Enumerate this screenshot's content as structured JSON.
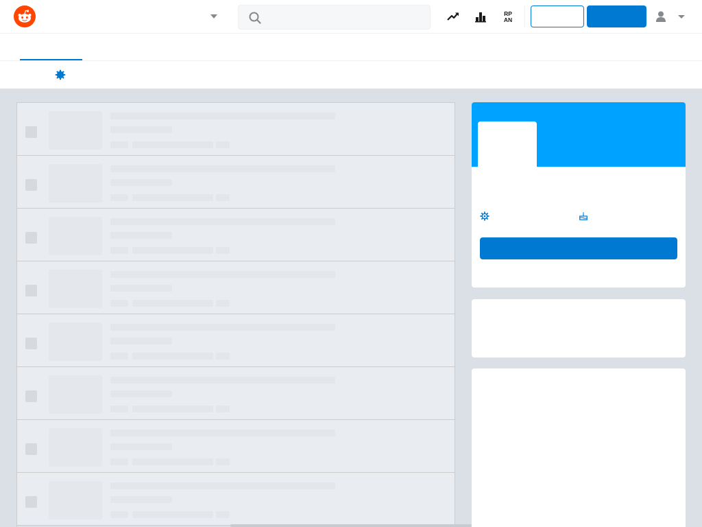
{
  "header": {
    "logo_icon": "reddit-alien-icon",
    "search": {
      "placeholder": "",
      "value": ""
    },
    "icons": [
      "trending-icon",
      "popular-chart-icon",
      "rpan-icon",
      "chevron-down-icon",
      "user-icon"
    ],
    "login_label": "",
    "signup_label": ""
  },
  "subnav": {
    "active_tab_label": ""
  },
  "colors": {
    "accent": "#0079d3",
    "banner": "#00a2ff",
    "logo": "#ff4500",
    "background": "#dae0e6"
  },
  "feed": {
    "posts": [
      {
        "title": "",
        "meta": ""
      },
      {
        "title": "",
        "meta": ""
      },
      {
        "title": "",
        "meta": ""
      },
      {
        "title": "",
        "meta": ""
      },
      {
        "title": "",
        "meta": ""
      },
      {
        "title": "",
        "meta": ""
      },
      {
        "title": "",
        "meta": ""
      },
      {
        "title": "",
        "meta": ""
      }
    ]
  },
  "sidebar": {
    "join_label": "",
    "members": "",
    "created": ""
  }
}
